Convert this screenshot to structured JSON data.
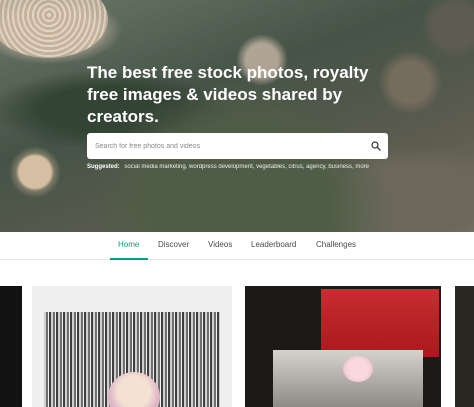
{
  "hero": {
    "title": "The best free stock photos, royalty free images & videos shared by creators.",
    "search_placeholder": "Search for free photos and videos",
    "suggested_label": "Suggested:",
    "suggested_terms": "social media marketing, wordpress development, vegetables, citrus, agency, business, more"
  },
  "tabs": [
    {
      "label": "Home",
      "active": true
    },
    {
      "label": "Discover",
      "active": false
    },
    {
      "label": "Videos",
      "active": false
    },
    {
      "label": "Leaderboard",
      "active": false
    },
    {
      "label": "Challenges",
      "active": false
    }
  ],
  "colors": {
    "accent": "#05a081",
    "tab_text": "#4a4a4a"
  },
  "icons": {
    "search": "search-icon"
  }
}
